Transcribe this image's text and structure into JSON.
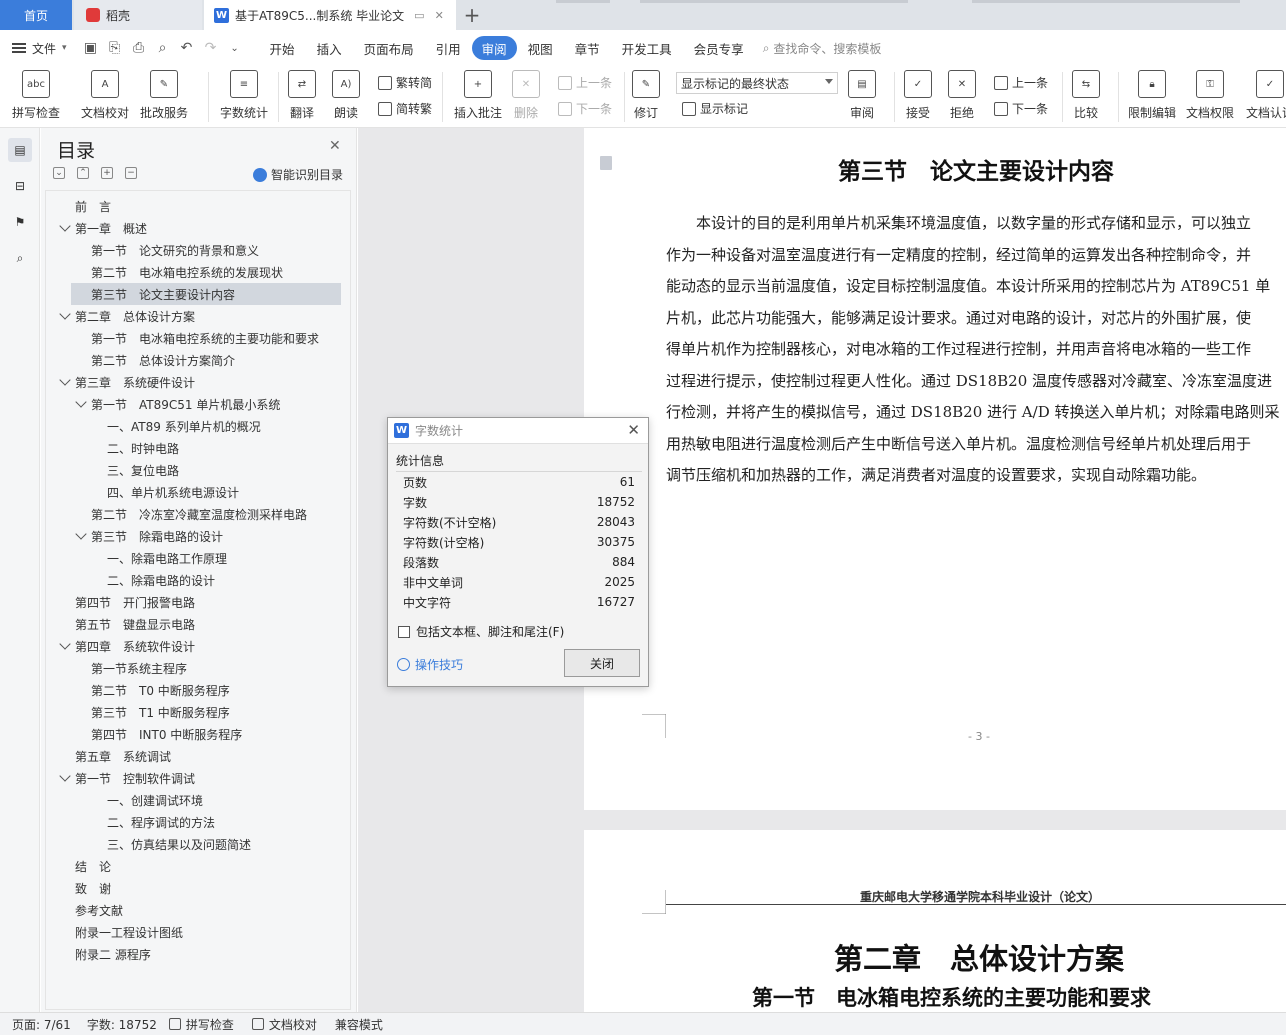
{
  "tabs": {
    "home": "首页",
    "daoke": "稻壳",
    "document": "基于AT89C5...制系统 毕业论文",
    "add": "+"
  },
  "menu": {
    "file": "文件",
    "items": [
      "开始",
      "插入",
      "页面布局",
      "引用",
      "审阅",
      "视图",
      "章节",
      "开发工具",
      "会员专享"
    ],
    "active": "审阅",
    "search": "查找命令、搜索模板"
  },
  "ribbon": {
    "spell_check": "拼写检查",
    "doc_proof": "文档校对",
    "batch_service": "批改服务",
    "word_count": "字数统计",
    "translate": "翻译",
    "read_aloud": "朗读",
    "trad_to_simp": "繁转简",
    "simp_to_trad": "简转繁",
    "insert_comment": "插入批注",
    "delete": "删除",
    "prev_comment": "上一条",
    "next_comment": "下一条",
    "track_changes": "修订",
    "markup_state": "显示标记的最终状态",
    "show_markup": "显示标记",
    "review": "审阅",
    "accept": "接受",
    "reject": "拒绝",
    "prev_change": "上一条",
    "next_change": "下一条",
    "compare": "比较",
    "restrict_edit": "限制编辑",
    "doc_permission": "文档权限",
    "doc_cert": "文档认证"
  },
  "nav": {
    "title": "目录",
    "smart_toc": "智能识别目录",
    "items": [
      "前　言",
      "第一章　概述",
      "第一节　论文研究的背景和意义",
      "第二节　电冰箱电控系统的发展现状",
      "第三节　论文主要设计内容",
      "第二章　总体设计方案",
      "第一节　电冰箱电控系统的主要功能和要求",
      "第二节　总体设计方案简介",
      "第三章　系统硬件设计",
      "第一节　AT89C51 单片机最小系统",
      "一、AT89 系列单片机的概况",
      "二、时钟电路",
      "三、复位电路",
      "四、单片机系统电源设计",
      "第二节　冷冻室冷藏室温度检测采样电路",
      "第三节　除霜电路的设计",
      "一、除霜电路工作原理",
      "二、除霜电路的设计",
      "第四节　开门报警电路",
      "第五节　键盘显示电路",
      "第四章　系统软件设计",
      "第一节系统主程序",
      "第二节　T0 中断服务程序",
      "第三节　T1 中断服务程序",
      "第四节　INT0 中断服务程序",
      "第五章　系统调试",
      "第一节　控制软件调试",
      "一、创建调试环境",
      "二、程序调试的方法",
      "三、仿真结果以及问题简述",
      "结　论",
      "致　谢",
      "参考文献",
      "附录一工程设计图纸",
      "附录二 源程序"
    ]
  },
  "doc": {
    "section_title": "第三节　论文主要设计内容",
    "paragraph_lines": [
      "　　本设计的目的是利用单片机采集环境温度值，以数字量的形式存储和显示，可以独立",
      "作为一种设备对温室温度进行有一定精度的控制，经过简单的运算发出各种控制命令，并",
      "能动态的显示当前温度值，设定目标控制温度值。本设计所采用的控制芯片为 AT89C51 单",
      "片机，此芯片功能强大，能够满足设计要求。通过对电路的设计，对芯片的外围扩展，使",
      "得单片机作为控制器核心，对电冰箱的工作过程进行控制，并用声音将电冰箱的一些工作",
      "过程进行提示，使控制过程更人性化。通过 DS18B20 温度传感器对冷藏室、冷冻室温度进",
      "行检测，并将产生的模拟信号，通过 DS18B20 进行 A/D 转换送入单片机；对除霜电路则采",
      "用热敏电阻进行温度检测后产生中断信号送入单片机。温度检测信号经单片机处理后用于",
      "调节压缩机和加热器的工作，满足消费者对温度的设置要求，实现自动除霜功能。"
    ],
    "page_number": "- 3 -",
    "next_header": "重庆邮电大学移通学院本科毕业设计（论文）",
    "next_chapter": "第二章　总体设计方案",
    "next_section": "第一节　电冰箱电控系统的主要功能和要求"
  },
  "dialog": {
    "title": "字数统计",
    "group": "统计信息",
    "rows": [
      {
        "label": "页数",
        "value": "61"
      },
      {
        "label": "字数",
        "value": "18752"
      },
      {
        "label": "字符数(不计空格)",
        "value": "28043"
      },
      {
        "label": "字符数(计空格)",
        "value": "30375"
      },
      {
        "label": "段落数",
        "value": "884"
      },
      {
        "label": "非中文单词",
        "value": "2025"
      },
      {
        "label": "中文字符",
        "value": "16727"
      }
    ],
    "include_label": "包括文本框、脚注和尾注(F)",
    "tips": "操作技巧",
    "close": "关闭"
  },
  "status": {
    "page": "页面: 7/61",
    "words": "字数: 18752",
    "spell": "拼写检查",
    "proof": "文档校对",
    "compat": "兼容模式"
  }
}
